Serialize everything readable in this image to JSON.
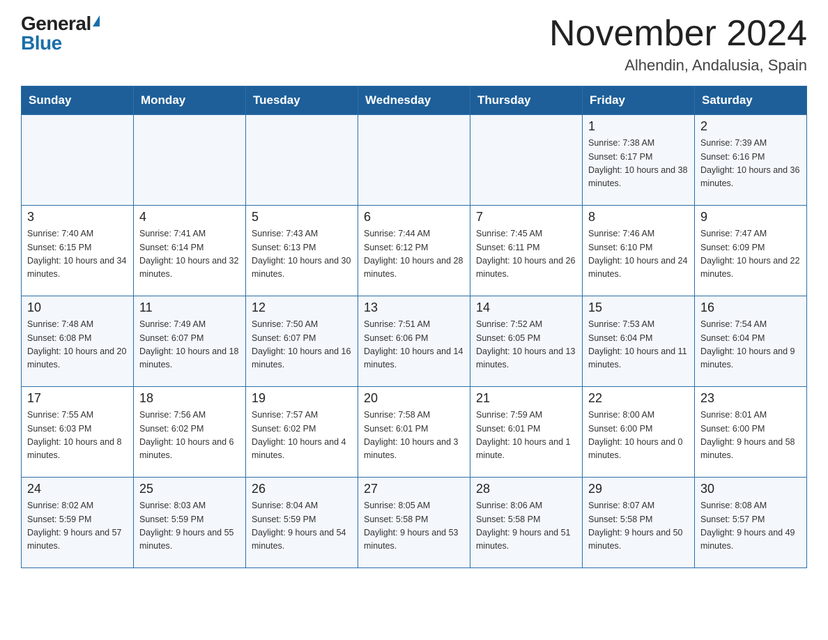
{
  "logo": {
    "general": "General",
    "triangle": "▶",
    "blue": "Blue"
  },
  "title": "November 2024",
  "subtitle": "Alhendin, Andalusia, Spain",
  "weekdays": [
    "Sunday",
    "Monday",
    "Tuesday",
    "Wednesday",
    "Thursday",
    "Friday",
    "Saturday"
  ],
  "weeks": [
    [
      {
        "day": "",
        "sunrise": "",
        "sunset": "",
        "daylight": ""
      },
      {
        "day": "",
        "sunrise": "",
        "sunset": "",
        "daylight": ""
      },
      {
        "day": "",
        "sunrise": "",
        "sunset": "",
        "daylight": ""
      },
      {
        "day": "",
        "sunrise": "",
        "sunset": "",
        "daylight": ""
      },
      {
        "day": "",
        "sunrise": "",
        "sunset": "",
        "daylight": ""
      },
      {
        "day": "1",
        "sunrise": "Sunrise: 7:38 AM",
        "sunset": "Sunset: 6:17 PM",
        "daylight": "Daylight: 10 hours and 38 minutes."
      },
      {
        "day": "2",
        "sunrise": "Sunrise: 7:39 AM",
        "sunset": "Sunset: 6:16 PM",
        "daylight": "Daylight: 10 hours and 36 minutes."
      }
    ],
    [
      {
        "day": "3",
        "sunrise": "Sunrise: 7:40 AM",
        "sunset": "Sunset: 6:15 PM",
        "daylight": "Daylight: 10 hours and 34 minutes."
      },
      {
        "day": "4",
        "sunrise": "Sunrise: 7:41 AM",
        "sunset": "Sunset: 6:14 PM",
        "daylight": "Daylight: 10 hours and 32 minutes."
      },
      {
        "day": "5",
        "sunrise": "Sunrise: 7:43 AM",
        "sunset": "Sunset: 6:13 PM",
        "daylight": "Daylight: 10 hours and 30 minutes."
      },
      {
        "day": "6",
        "sunrise": "Sunrise: 7:44 AM",
        "sunset": "Sunset: 6:12 PM",
        "daylight": "Daylight: 10 hours and 28 minutes."
      },
      {
        "day": "7",
        "sunrise": "Sunrise: 7:45 AM",
        "sunset": "Sunset: 6:11 PM",
        "daylight": "Daylight: 10 hours and 26 minutes."
      },
      {
        "day": "8",
        "sunrise": "Sunrise: 7:46 AM",
        "sunset": "Sunset: 6:10 PM",
        "daylight": "Daylight: 10 hours and 24 minutes."
      },
      {
        "day": "9",
        "sunrise": "Sunrise: 7:47 AM",
        "sunset": "Sunset: 6:09 PM",
        "daylight": "Daylight: 10 hours and 22 minutes."
      }
    ],
    [
      {
        "day": "10",
        "sunrise": "Sunrise: 7:48 AM",
        "sunset": "Sunset: 6:08 PM",
        "daylight": "Daylight: 10 hours and 20 minutes."
      },
      {
        "day": "11",
        "sunrise": "Sunrise: 7:49 AM",
        "sunset": "Sunset: 6:07 PM",
        "daylight": "Daylight: 10 hours and 18 minutes."
      },
      {
        "day": "12",
        "sunrise": "Sunrise: 7:50 AM",
        "sunset": "Sunset: 6:07 PM",
        "daylight": "Daylight: 10 hours and 16 minutes."
      },
      {
        "day": "13",
        "sunrise": "Sunrise: 7:51 AM",
        "sunset": "Sunset: 6:06 PM",
        "daylight": "Daylight: 10 hours and 14 minutes."
      },
      {
        "day": "14",
        "sunrise": "Sunrise: 7:52 AM",
        "sunset": "Sunset: 6:05 PM",
        "daylight": "Daylight: 10 hours and 13 minutes."
      },
      {
        "day": "15",
        "sunrise": "Sunrise: 7:53 AM",
        "sunset": "Sunset: 6:04 PM",
        "daylight": "Daylight: 10 hours and 11 minutes."
      },
      {
        "day": "16",
        "sunrise": "Sunrise: 7:54 AM",
        "sunset": "Sunset: 6:04 PM",
        "daylight": "Daylight: 10 hours and 9 minutes."
      }
    ],
    [
      {
        "day": "17",
        "sunrise": "Sunrise: 7:55 AM",
        "sunset": "Sunset: 6:03 PM",
        "daylight": "Daylight: 10 hours and 8 minutes."
      },
      {
        "day": "18",
        "sunrise": "Sunrise: 7:56 AM",
        "sunset": "Sunset: 6:02 PM",
        "daylight": "Daylight: 10 hours and 6 minutes."
      },
      {
        "day": "19",
        "sunrise": "Sunrise: 7:57 AM",
        "sunset": "Sunset: 6:02 PM",
        "daylight": "Daylight: 10 hours and 4 minutes."
      },
      {
        "day": "20",
        "sunrise": "Sunrise: 7:58 AM",
        "sunset": "Sunset: 6:01 PM",
        "daylight": "Daylight: 10 hours and 3 minutes."
      },
      {
        "day": "21",
        "sunrise": "Sunrise: 7:59 AM",
        "sunset": "Sunset: 6:01 PM",
        "daylight": "Daylight: 10 hours and 1 minute."
      },
      {
        "day": "22",
        "sunrise": "Sunrise: 8:00 AM",
        "sunset": "Sunset: 6:00 PM",
        "daylight": "Daylight: 10 hours and 0 minutes."
      },
      {
        "day": "23",
        "sunrise": "Sunrise: 8:01 AM",
        "sunset": "Sunset: 6:00 PM",
        "daylight": "Daylight: 9 hours and 58 minutes."
      }
    ],
    [
      {
        "day": "24",
        "sunrise": "Sunrise: 8:02 AM",
        "sunset": "Sunset: 5:59 PM",
        "daylight": "Daylight: 9 hours and 57 minutes."
      },
      {
        "day": "25",
        "sunrise": "Sunrise: 8:03 AM",
        "sunset": "Sunset: 5:59 PM",
        "daylight": "Daylight: 9 hours and 55 minutes."
      },
      {
        "day": "26",
        "sunrise": "Sunrise: 8:04 AM",
        "sunset": "Sunset: 5:59 PM",
        "daylight": "Daylight: 9 hours and 54 minutes."
      },
      {
        "day": "27",
        "sunrise": "Sunrise: 8:05 AM",
        "sunset": "Sunset: 5:58 PM",
        "daylight": "Daylight: 9 hours and 53 minutes."
      },
      {
        "day": "28",
        "sunrise": "Sunrise: 8:06 AM",
        "sunset": "Sunset: 5:58 PM",
        "daylight": "Daylight: 9 hours and 51 minutes."
      },
      {
        "day": "29",
        "sunrise": "Sunrise: 8:07 AM",
        "sunset": "Sunset: 5:58 PM",
        "daylight": "Daylight: 9 hours and 50 minutes."
      },
      {
        "day": "30",
        "sunrise": "Sunrise: 8:08 AM",
        "sunset": "Sunset: 5:57 PM",
        "daylight": "Daylight: 9 hours and 49 minutes."
      }
    ]
  ]
}
